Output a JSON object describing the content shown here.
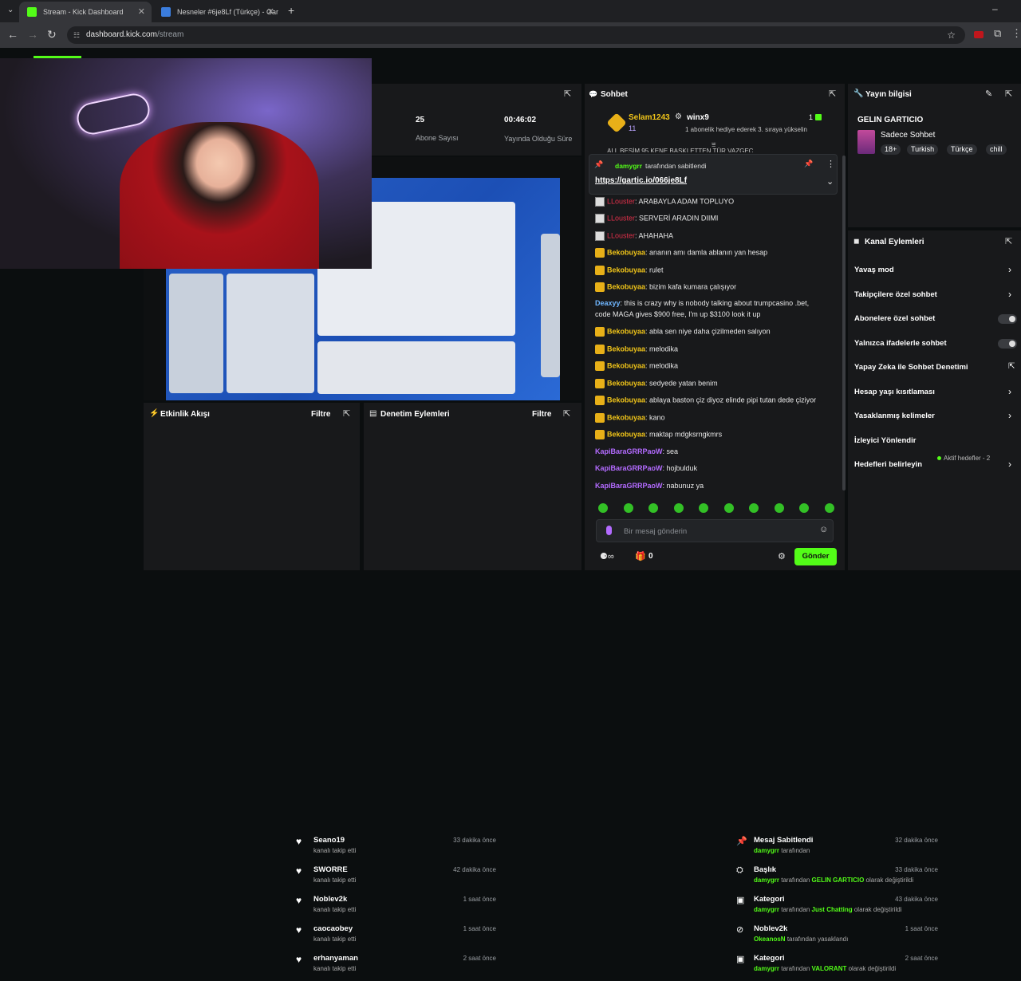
{
  "browser": {
    "tabs": [
      {
        "title": "Stream - Kick Dashboard",
        "active": true
      },
      {
        "title": "Nesneler #6je8Lf (Türkçe) - Gar",
        "active": false
      }
    ],
    "url_domain": "dashboard.kick.com",
    "url_path": "/stream"
  },
  "stats": {
    "subs_value": "25",
    "subs_label": "Abone Sayısı",
    "time_value": "00:46:02",
    "time_label": "Yayında Olduğu Süre"
  },
  "chat": {
    "title": "Sohbet",
    "top_user": "Selam1243",
    "top_count": "11",
    "gift_user": "winx9",
    "gift_count": "1",
    "gift_text": "1 abonelik hediye ederek 3. sıraya yükselin",
    "partial_msg": "ALL BEŞİM 95 KENE BAŞKI ETTEN TÜR VAZGEÇ",
    "pinned_by": "damygrr",
    "pinned_suffix": "tarafından sabitlendi",
    "pinned_link": "https://gartic.io/066je8Lf",
    "messages": [
      {
        "user": "LLouster",
        "text": "ARABAYLA ADAM TOPLUYO",
        "style": "red"
      },
      {
        "user": "LLouster",
        "text": "SERVERİ ARADIN DIIMI",
        "style": "red"
      },
      {
        "user": "LLouster",
        "text": "AHAHAHA",
        "style": "red"
      },
      {
        "user": "Bekobuyaa",
        "text": "ananın amı damla ablanın yan hesap",
        "style": "gold"
      },
      {
        "user": "Bekobuyaa",
        "text": "rulet",
        "style": "gold"
      },
      {
        "user": "Bekobuyaa",
        "text": "bizim kafa kumara çalışıyor",
        "style": "gold"
      },
      {
        "user": "Deaxyy",
        "text": "this is crazy why is nobody talking about trumpcasino .bet,",
        "text2": "code MAGA gives $900 free, I'm up $3100 look it up",
        "style": "blue"
      },
      {
        "user": "Bekobuyaa",
        "text": "abla sen niye daha çizilmeden salıyon",
        "style": "gold"
      },
      {
        "user": "Bekobuyaa",
        "text": "melodika",
        "style": "gold"
      },
      {
        "user": "Bekobuyaa",
        "text": "melodika",
        "style": "gold"
      },
      {
        "user": "Bekobuyaa",
        "text": "sedyede yatan benim",
        "style": "gold"
      },
      {
        "user": "Bekobuyaa",
        "text": "ablaya baston çiz diyoz elinde pipi tutan dede çiziyor",
        "style": "gold"
      },
      {
        "user": "Bekobuyaa",
        "text": "kano",
        "style": "gold"
      },
      {
        "user": "Bekobuyaa",
        "text": "maktap mdgksrngkmrs",
        "style": "gold"
      },
      {
        "user": "KapiBaraGRRPaoW",
        "text": "sea",
        "style": "purple"
      },
      {
        "user": "KapiBaraGRRPaoW",
        "text": "hojbulduk",
        "style": "purple"
      },
      {
        "user": "KapiBaraGRRPaoW",
        "text": "nabunuz ya",
        "style": "purple"
      }
    ],
    "input_placeholder": "Bir mesaj gönderin",
    "points": "0",
    "send_label": "Gönder"
  },
  "stream_info": {
    "title": "Yayın bilgisi",
    "stream_title": "GELIN GARTICIO",
    "category": "Sadece Sohbet",
    "tags": [
      "18+",
      "Turkish",
      "Türkçe",
      "chill"
    ]
  },
  "channel_actions": {
    "title": "Kanal Eylemleri",
    "rows": [
      {
        "label": "Yavaş mod",
        "control": "chevron"
      },
      {
        "label": "Takipçilere özel sohbet",
        "control": "chevron"
      },
      {
        "label": "Abonelere özel sohbet",
        "control": "toggle"
      },
      {
        "label": "Yalnızca ifadelerle sohbet",
        "control": "toggle"
      },
      {
        "label": "Yapay Zeka ile Sohbet Denetimi",
        "control": "external"
      },
      {
        "label": "Hesap yaşı kısıtlaması",
        "control": "chevron"
      },
      {
        "label": "Yasaklanmış kelimeler",
        "control": "chevron"
      },
      {
        "label": "İzleyici Yönlendir",
        "control": "none"
      },
      {
        "label": "Hedefleri belirleyin",
        "control": "chevron"
      }
    ],
    "goals_status": "Aktif hedefler - 2"
  },
  "activity": {
    "title": "Etkinlik Akışı",
    "filter": "Filtre",
    "items": [
      {
        "name": "Seano19",
        "sub": "kanalı takip etti",
        "time": "33 dakika önce"
      },
      {
        "name": "SWORRE",
        "sub": "kanalı takip etti",
        "time": "42 dakika önce"
      },
      {
        "name": "Noblev2k",
        "sub": "kanalı takip etti",
        "time": "1 saat önce"
      },
      {
        "name": "caocaobey",
        "sub": "kanalı takip etti",
        "time": "1 saat önce"
      },
      {
        "name": "erhanyaman",
        "sub": "kanalı takip etti",
        "time": "2 saat önce"
      }
    ]
  },
  "moderation": {
    "title": "Denetim Eylemleri",
    "filter": "Filtre",
    "items": [
      {
        "name": "Mesaj Sabitlendi",
        "user": "damygrr",
        "mid": "tarafından",
        "target": "",
        "end": "",
        "time": "32 dakika önce"
      },
      {
        "name": "Başlık",
        "user": "damygrr",
        "mid": "tarafından",
        "target": "GELIN GARTICIO",
        "end": "olarak değiştirildi",
        "time": "33 dakika önce"
      },
      {
        "name": "Kategori",
        "user": "damygrr",
        "mid": "tarafından",
        "target": "Just Chatting",
        "end": "olarak değiştirildi",
        "time": "43 dakika önce"
      },
      {
        "name": "Noblev2k",
        "user": "OkeanosN",
        "mid": "tarafından yasaklandı",
        "target": "",
        "end": "",
        "time": "1 saat önce"
      },
      {
        "name": "Kategori",
        "user": "damygrr",
        "mid": "tarafından",
        "target": "VALORANT",
        "end": "olarak değiştirildi",
        "time": "2 saat önce"
      }
    ]
  }
}
